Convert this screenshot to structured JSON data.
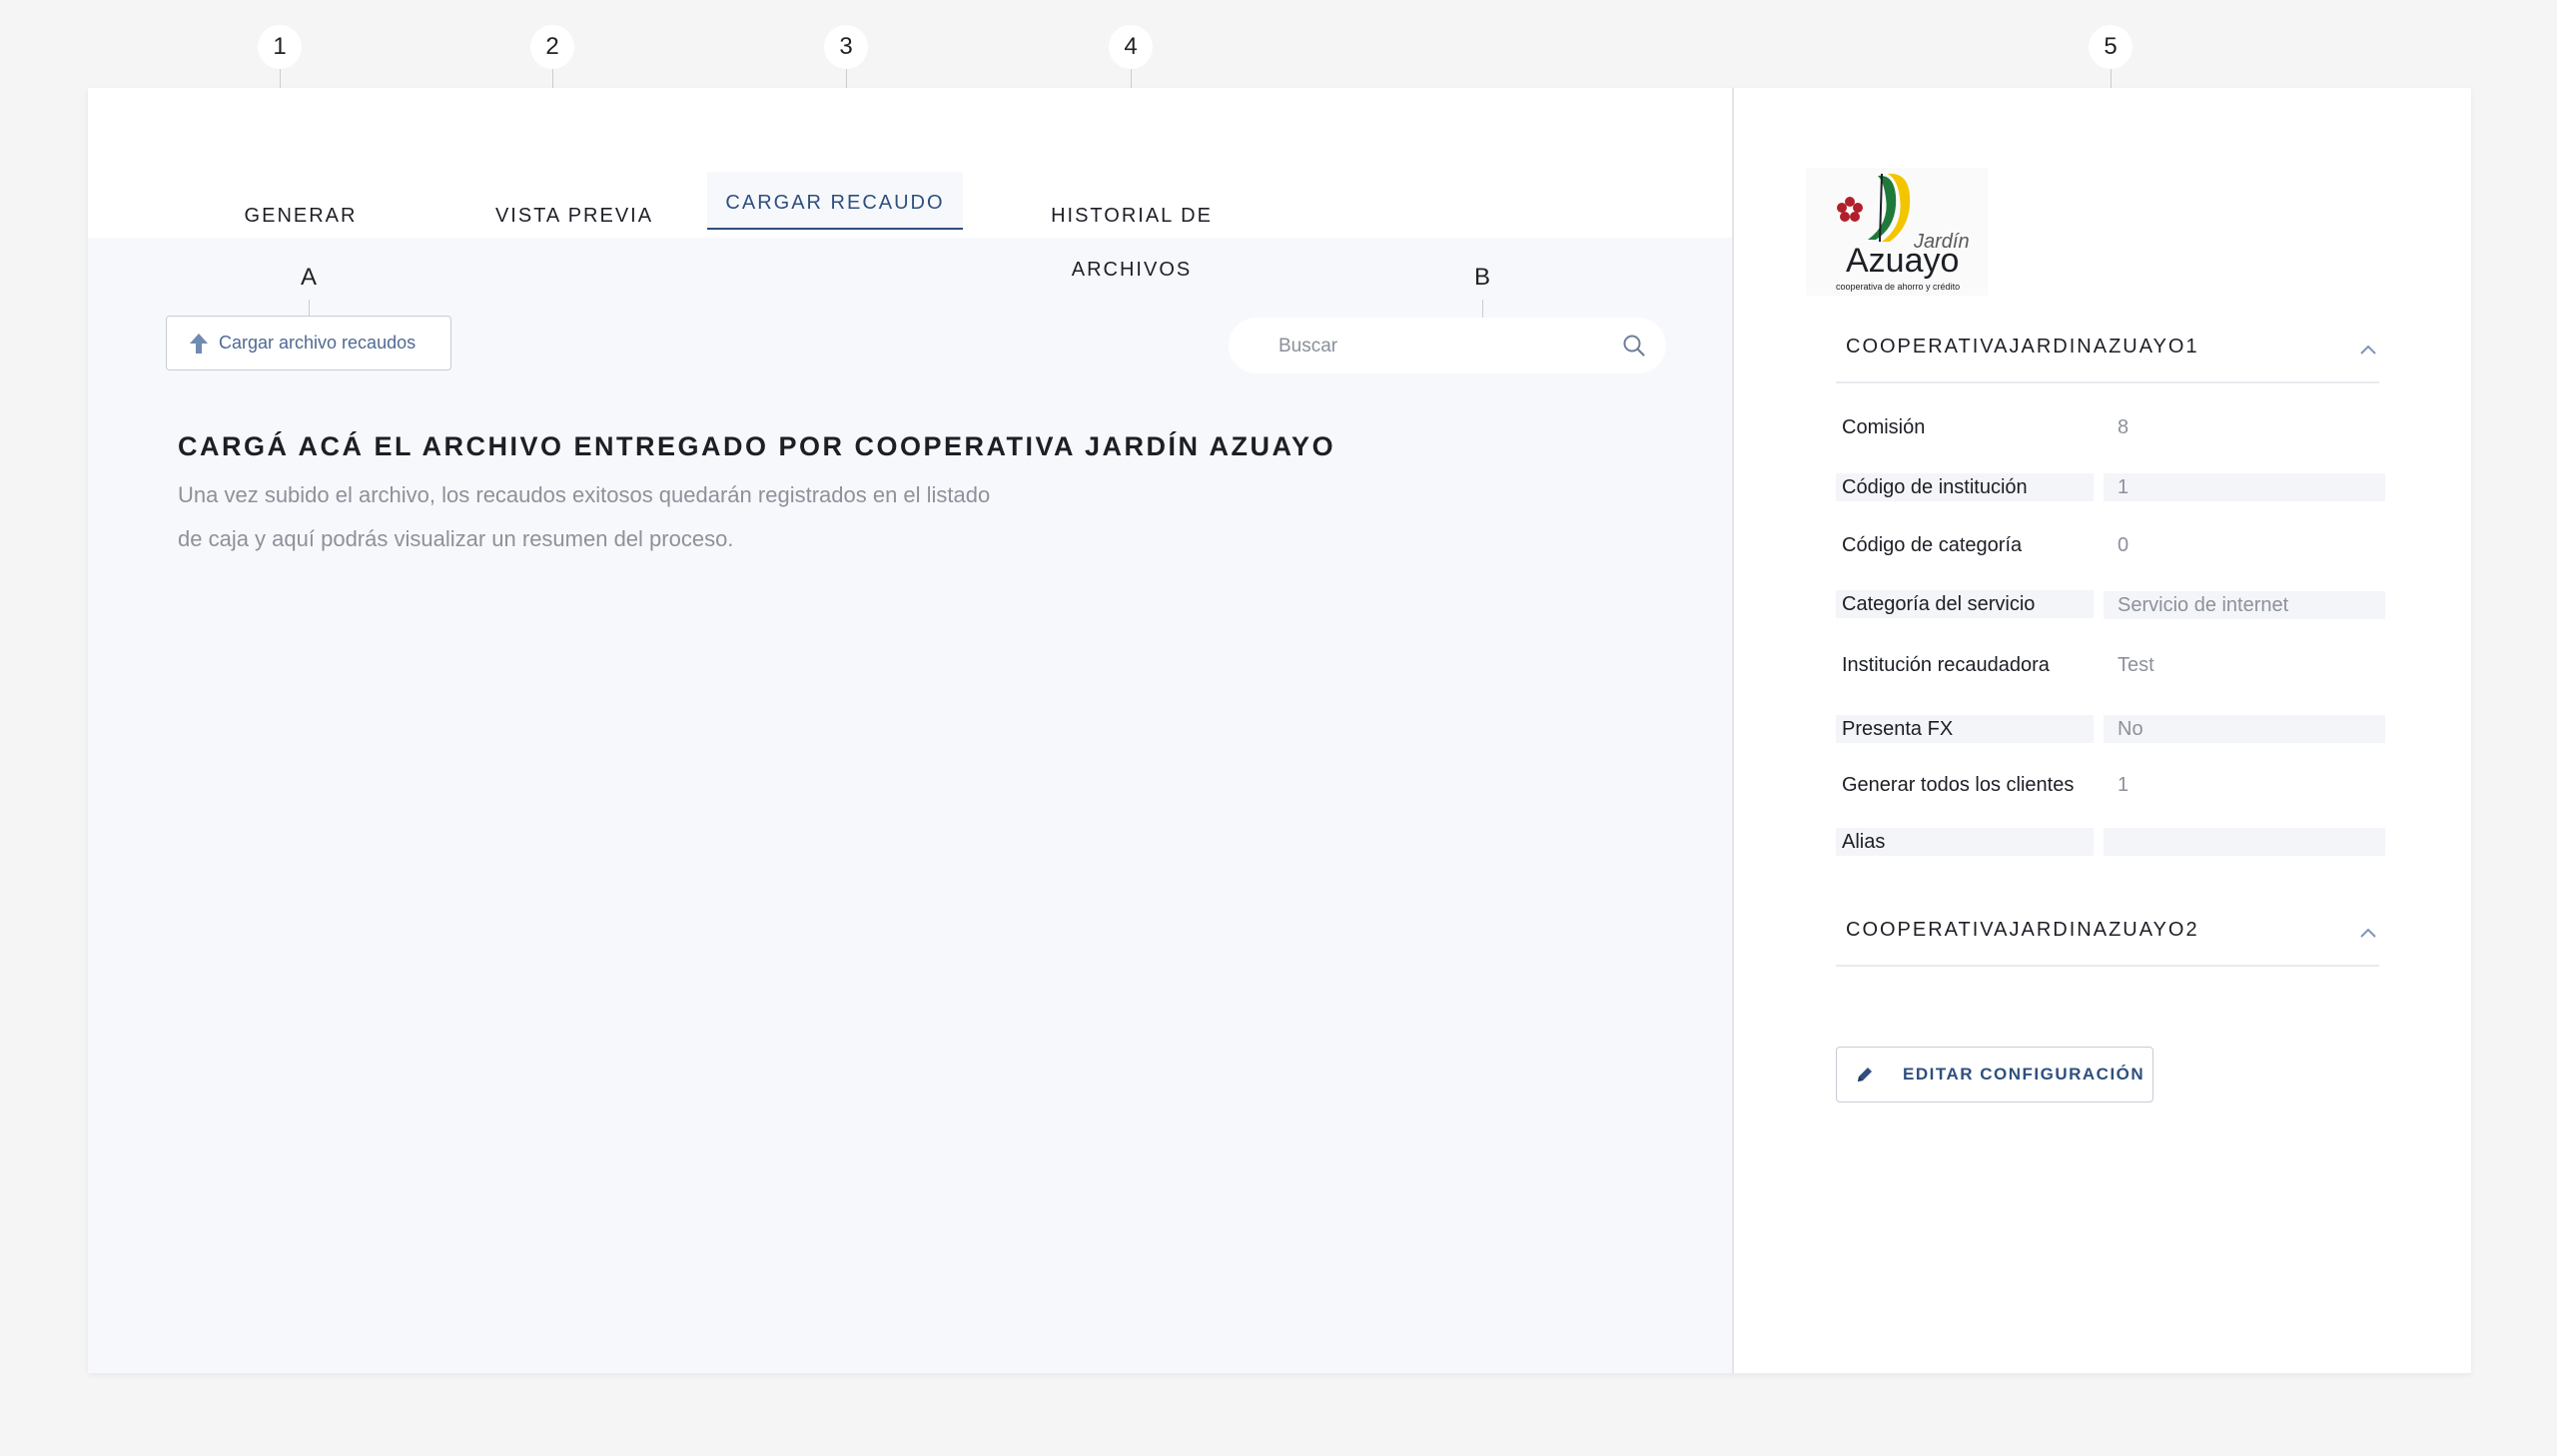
{
  "tabs": [
    {
      "label": "GENERAR",
      "active": false
    },
    {
      "label": "VISTA PREVIA",
      "active": false
    },
    {
      "label": "CARGAR RECAUDO",
      "active": true
    },
    {
      "label": "HISTORIAL DE ARCHIVOS",
      "active": false
    }
  ],
  "callouts": {
    "c1": "1",
    "c2": "2",
    "c3": "3",
    "c4": "4",
    "c5": "5",
    "cA": "A",
    "cB": "B"
  },
  "upload": {
    "label": "Cargar archivo recaudos",
    "icon": "upload-arrow-icon"
  },
  "search": {
    "placeholder": "Buscar",
    "icon": "search-icon"
  },
  "main": {
    "title": "CARGÁ ACÁ EL ARCHIVO ENTREGADO POR COOPERATIVA JARDÍN AZUAYO",
    "line1": "Una vez subido el archivo, los recaudos exitosos quedarán registrados en el listado",
    "line2": "de caja y aquí podrás visualizar un resumen del proceso."
  },
  "logo": {
    "brand_top": "Jardín",
    "brand_main": "Azuayo",
    "tagline": "cooperativa de ahorro y crédito"
  },
  "config": {
    "section1_title": "COOPERATIVAJARDINAZUAYO1",
    "section2_title": "COOPERATIVAJARDINAZUAYO2",
    "rows": [
      {
        "label": "Comisión",
        "value": "8"
      },
      {
        "label": "Código de institución",
        "value": "1"
      },
      {
        "label": "Código de categoría",
        "value": "0"
      },
      {
        "label": "Categoría del servicio",
        "value": "Servicio de internet"
      },
      {
        "label": "Institución recaudadora",
        "value": "Test"
      },
      {
        "label": "Presenta FX",
        "value": "No"
      },
      {
        "label": "Generar todos los clientes",
        "value": "1"
      },
      {
        "label": "Alias",
        "value": ""
      }
    ],
    "edit_label": "EDITAR CONFIGURACIÓN"
  },
  "colors": {
    "accent": "#2e4f7f",
    "muted_text": "#8d919a",
    "panel_bg": "#f7f8fb"
  }
}
